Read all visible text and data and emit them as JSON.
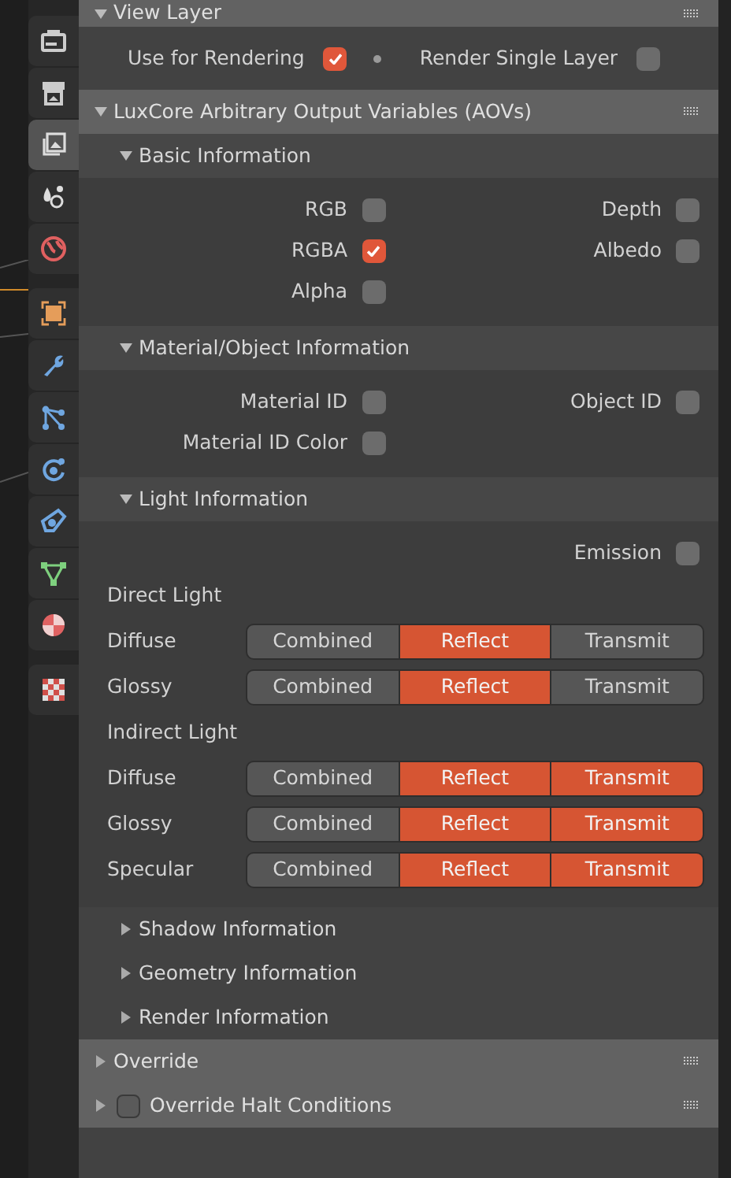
{
  "sidebar_groups": [
    [
      {
        "kind": "render",
        "selected": false
      },
      {
        "kind": "output",
        "selected": false
      },
      {
        "kind": "view_layer",
        "selected": true
      },
      {
        "kind": "scene",
        "selected": false
      },
      {
        "kind": "world",
        "selected": false
      }
    ],
    [
      {
        "kind": "object",
        "selected": false
      },
      {
        "kind": "modifiers",
        "selected": false
      },
      {
        "kind": "particles",
        "selected": false
      },
      {
        "kind": "physics",
        "selected": false
      },
      {
        "kind": "constraints",
        "selected": false
      },
      {
        "kind": "data",
        "selected": false
      },
      {
        "kind": "material",
        "selected": false
      }
    ],
    [
      {
        "kind": "texture",
        "selected": false
      }
    ]
  ],
  "view_layer": {
    "title": "View Layer",
    "expanded": true,
    "options": [
      {
        "label": "Use for Rendering",
        "checked": true
      },
      {
        "label": "Render Single Layer",
        "checked": false
      }
    ]
  },
  "aov_panel": {
    "title": "LuxCore Arbitrary Output Variables (AOVs)",
    "expanded": true,
    "subpanels": [
      {
        "title": "Basic Information",
        "expanded": true,
        "rows": [
          {
            "kind": "checks",
            "left": {
              "label": "RGB",
              "checked": false
            },
            "right": {
              "label": "Depth",
              "checked": false
            }
          },
          {
            "kind": "checks",
            "left": {
              "label": "RGBA",
              "checked": true
            },
            "right": {
              "label": "Albedo",
              "checked": false
            }
          },
          {
            "kind": "checks",
            "left": {
              "label": "Alpha",
              "checked": false
            }
          }
        ]
      },
      {
        "title": "Material/Object Information",
        "expanded": true,
        "rows": [
          {
            "kind": "checks",
            "left": {
              "label": "Material ID",
              "checked": false
            },
            "right": {
              "label": "Object ID",
              "checked": false
            }
          },
          {
            "kind": "checks",
            "left": {
              "label": "Material ID Color",
              "checked": false
            }
          }
        ]
      },
      {
        "title": "Light Information",
        "expanded": true,
        "rows": [
          {
            "kind": "checks",
            "right": {
              "label": "Emission",
              "checked": false
            }
          },
          {
            "kind": "heading",
            "label": "Direct Light"
          },
          {
            "kind": "toggles",
            "label": "Diffuse",
            "options": [
              {
                "label": "Combined",
                "on": false
              },
              {
                "label": "Reflect",
                "on": true
              },
              {
                "label": "Transmit",
                "on": false
              }
            ]
          },
          {
            "kind": "toggles",
            "label": "Glossy",
            "options": [
              {
                "label": "Combined",
                "on": false
              },
              {
                "label": "Reflect",
                "on": true
              },
              {
                "label": "Transmit",
                "on": false
              }
            ]
          },
          {
            "kind": "heading",
            "label": "Indirect Light"
          },
          {
            "kind": "toggles",
            "label": "Diffuse",
            "options": [
              {
                "label": "Combined",
                "on": false
              },
              {
                "label": "Reflect",
                "on": true
              },
              {
                "label": "Transmit",
                "on": true
              }
            ]
          },
          {
            "kind": "toggles",
            "label": "Glossy",
            "options": [
              {
                "label": "Combined",
                "on": false
              },
              {
                "label": "Reflect",
                "on": true
              },
              {
                "label": "Transmit",
                "on": true
              }
            ]
          },
          {
            "kind": "toggles",
            "label": "Specular",
            "options": [
              {
                "label": "Combined",
                "on": false
              },
              {
                "label": "Reflect",
                "on": true
              },
              {
                "label": "Transmit",
                "on": true
              }
            ]
          }
        ]
      },
      {
        "title": "Shadow Information",
        "expanded": false
      },
      {
        "title": "Geometry Information",
        "expanded": false
      },
      {
        "title": "Render Information",
        "expanded": false
      }
    ]
  },
  "closed_panels": [
    {
      "title": "Override",
      "expanded": false
    },
    {
      "title": "Override Halt Conditions",
      "expanded": false,
      "checked": false
    }
  ]
}
